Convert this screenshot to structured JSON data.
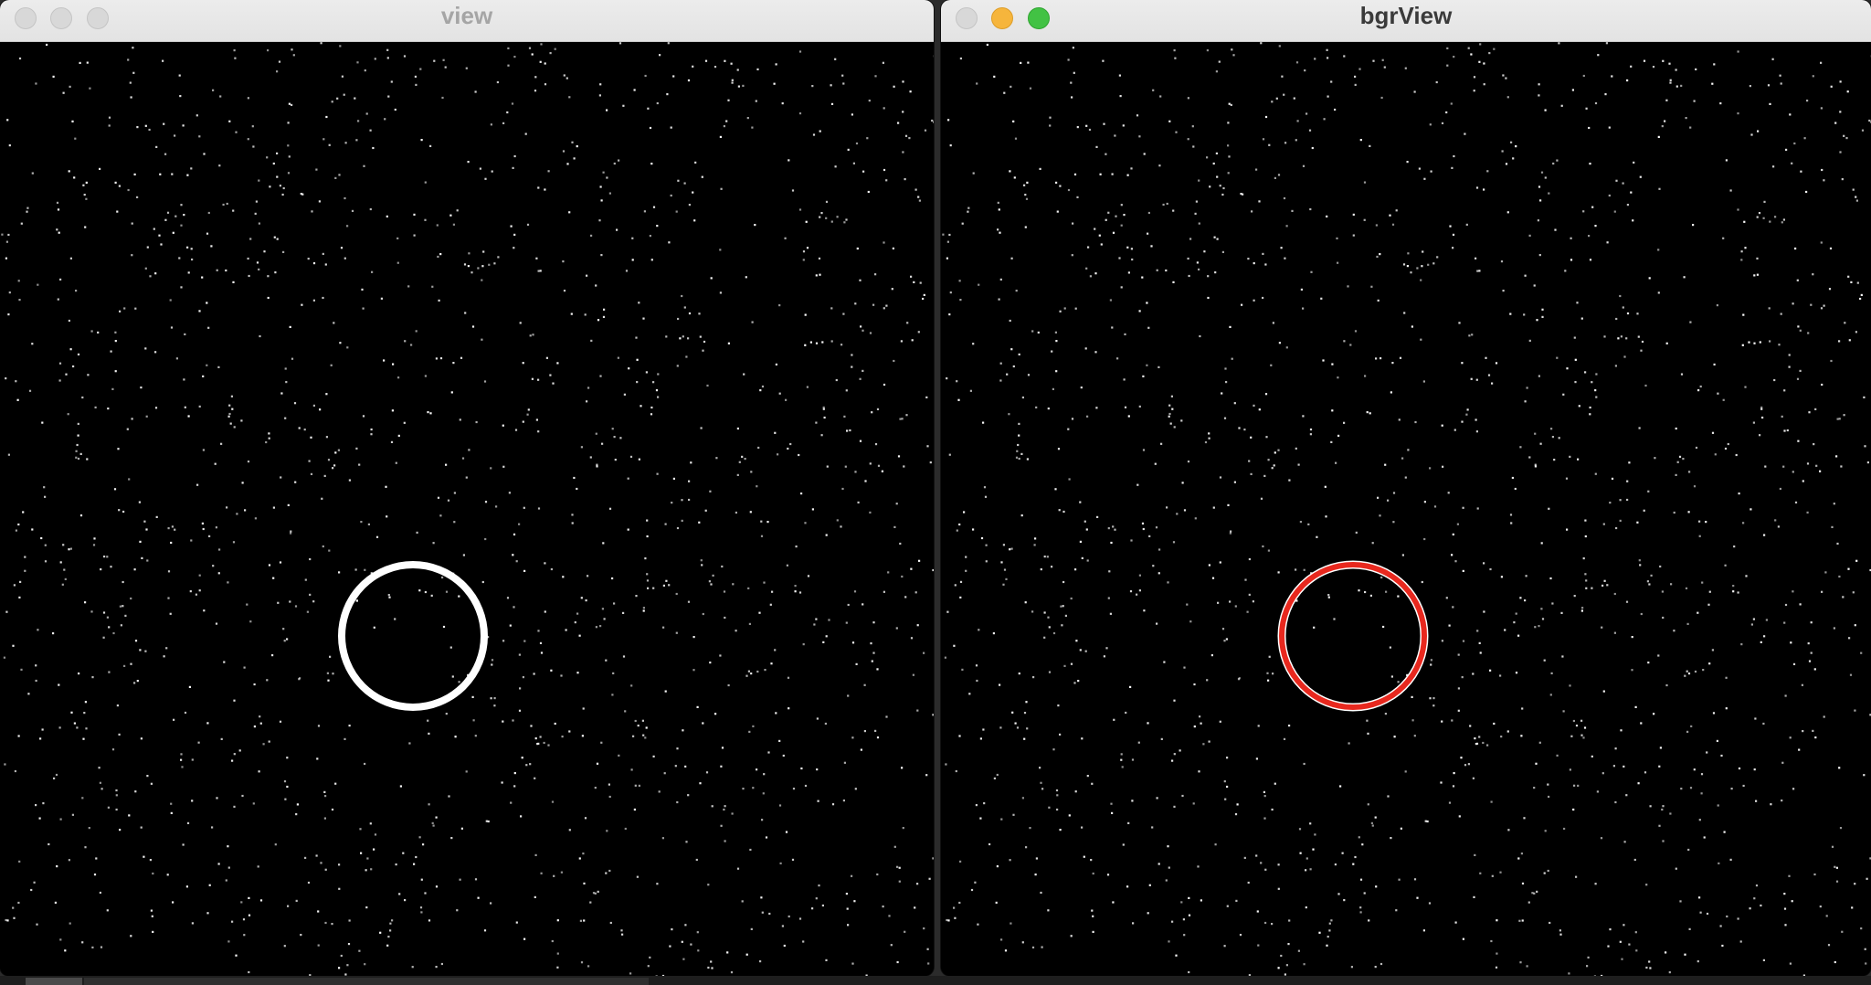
{
  "windows": {
    "left": {
      "title": "view",
      "focused": false,
      "circle_color": "#ffffff"
    },
    "right": {
      "title": "bgrView",
      "focused": true,
      "circle_color": "#e8281e"
    }
  },
  "colors": {
    "titlebar": "#e6e6e6",
    "canvas_background": "#000000",
    "noise_dots": "#ffffff",
    "traffic_minimize": "#f6b53c",
    "traffic_maximize": "#42c244",
    "traffic_inactive": "#d8d8d8"
  },
  "icons": {
    "close": "close-icon",
    "minimize": "minimize-icon",
    "maximize": "maximize-icon"
  }
}
